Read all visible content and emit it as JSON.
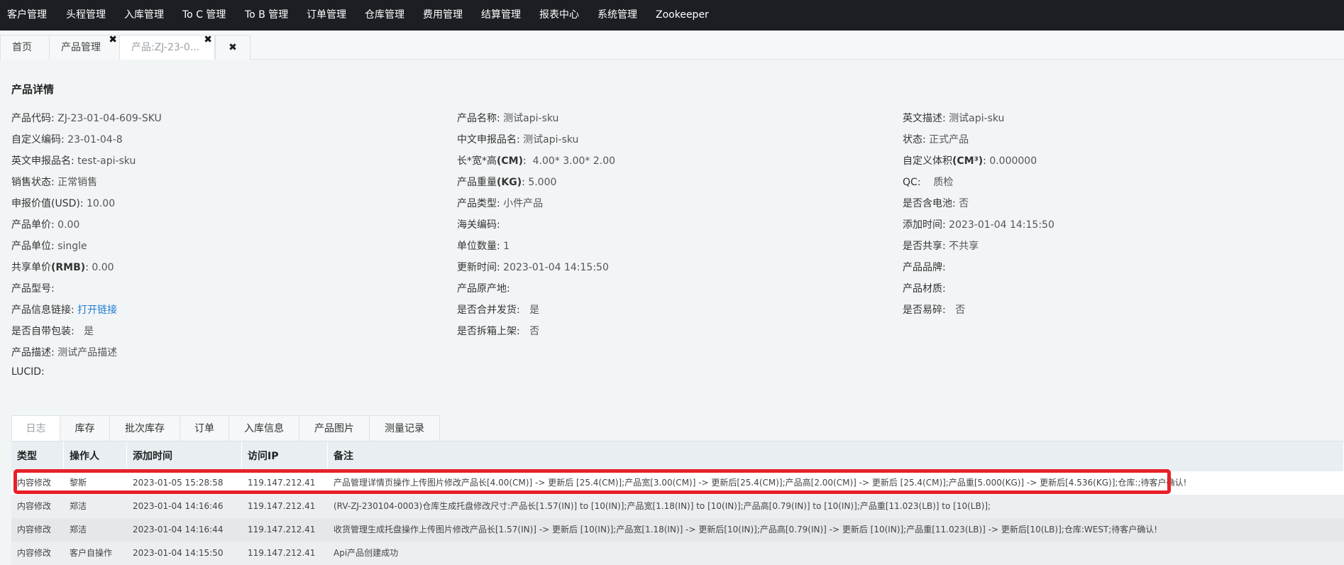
{
  "topnav": {
    "items": [
      "客户管理",
      "头程管理",
      "入库管理",
      "To C 管理",
      "To B 管理",
      "订单管理",
      "仓库管理",
      "费用管理",
      "结算管理",
      "报表中心",
      "系统管理",
      "Zookeeper"
    ]
  },
  "tabs": {
    "home": "首页",
    "product_mgmt": "产品管理",
    "product_detail": "产品:ZJ-23-0...",
    "close_symbol": "✖"
  },
  "section": {
    "title": "产品详情"
  },
  "fields": {
    "col1": [
      {
        "label": "产品代码:",
        "value": "ZJ-23-01-04-609-SKU"
      },
      {
        "label": "自定义编码:",
        "value": "23-01-04-8"
      },
      {
        "label": "英文申报品名:",
        "value": "test-api-sku"
      },
      {
        "label": "销售状态:",
        "value": "正常销售"
      },
      {
        "label": "申报价值(USD):",
        "value": "10.00"
      },
      {
        "label": "产品单价:",
        "value": "0.00"
      },
      {
        "label": "产品单位:",
        "value": "single"
      },
      {
        "label_pre": "共享单价",
        "label_bold": "(RMB)",
        "label_post": ":",
        "value": "0.00"
      },
      {
        "label": "产品型号:",
        "value": ""
      },
      {
        "label": "产品信息链接:",
        "value": "打开链接"
      },
      {
        "label": "是否自带包装:",
        "value": "是"
      },
      {
        "label": "产品描述:",
        "value": "测试产品描述"
      },
      {
        "label": "LUCID:",
        "value": ""
      }
    ],
    "col2": [
      {
        "label": "产品名称:",
        "value": "测试api-sku"
      },
      {
        "label": "中文申报品名:",
        "value": "测试api-sku"
      },
      {
        "label_pre": "长*宽*高",
        "label_bold": "(CM)",
        "label_post": ":",
        "value": "4.00* 3.00* 2.00"
      },
      {
        "label_pre": "产品重量",
        "label_bold": "(KG)",
        "label_post": ":",
        "value": "5.000"
      },
      {
        "label": "产品类型:",
        "value": "小件产品"
      },
      {
        "label": "海关编码:",
        "value": ""
      },
      {
        "label": "单位数量:",
        "value": "1"
      },
      {
        "label": "更新时间:",
        "value": "2023-01-04 14:15:50"
      },
      {
        "label": "产品原产地:",
        "value": ""
      },
      {
        "label": "是否合并发货:",
        "value": "是"
      },
      {
        "label": "是否拆箱上架:",
        "value": "否"
      }
    ],
    "col3": [
      {
        "label": "英文描述:",
        "value": "测试api-sku"
      },
      {
        "label": "状态:",
        "value": "正式产品"
      },
      {
        "label_pre": "自定义体积",
        "label_bold": "(CM³)",
        "label_post": ":",
        "value": "0.000000"
      },
      {
        "label": "QC:",
        "value": "质检"
      },
      {
        "label": "是否含电池:",
        "value": "否"
      },
      {
        "label": "添加时间:",
        "value": "2023-01-04 14:15:50"
      },
      {
        "label": "是否共享:",
        "value": "不共享"
      },
      {
        "label": "产品品牌:",
        "value": ""
      },
      {
        "label": "产品材质:",
        "value": ""
      },
      {
        "label": "是否易碎:",
        "value": "否"
      }
    ]
  },
  "detail_tabs": [
    "日志",
    "库存",
    "批次库存",
    "订单",
    "入库信息",
    "产品图片",
    "测量记录"
  ],
  "log_table": {
    "headers": [
      "类型",
      "操作人",
      "添加时间",
      "访问IP",
      "备注"
    ],
    "rows": [
      [
        "内容修改",
        "黎斯",
        "2023-01-05 15:28:58",
        "119.147.212.41",
        "产品管理详情页操作上传图片修改产品长[4.00(CM)] -> 更新后 [25.4(CM)];产品宽[3.00(CM)] -> 更新后[25.4(CM)];产品高[2.00(CM)] -> 更新后 [25.4(CM)];产品重[5.000(KG)] -> 更新后[4.536(KG)];仓库:;待客户确认!"
      ],
      [
        "内容修改",
        "郑洁",
        "2023-01-04 14:16:46",
        "119.147.212.41",
        "(RV-ZJ-230104-0003)仓库生成托盘修改尺寸:产品长[1.57(IN)] to [10(IN)];产品宽[1.18(IN)] to [10(IN)];产品高[0.79(IN)] to [10(IN)];产品重[11.023(LB)] to [10(LB)];"
      ],
      [
        "内容修改",
        "郑洁",
        "2023-01-04 14:16:44",
        "119.147.212.41",
        "收货管理生成托盘操作上传图片修改产品长[1.57(IN)] -> 更新后 [10(IN)];产品宽[1.18(IN)] -> 更新后[10(IN)];产品高[0.79(IN)] -> 更新后 [10(IN)];产品重[11.023(LB)] -> 更新后[10(LB)];仓库:WEST;待客户确认!"
      ],
      [
        "内容修改",
        "客户自操作",
        "2023-01-04 14:15:50",
        "119.147.212.41",
        "Api产品创建成功"
      ]
    ]
  },
  "colors": {
    "nav_bg": "#1b1e22",
    "highlight": "#e8202a",
    "link": "#1f7ad1"
  }
}
